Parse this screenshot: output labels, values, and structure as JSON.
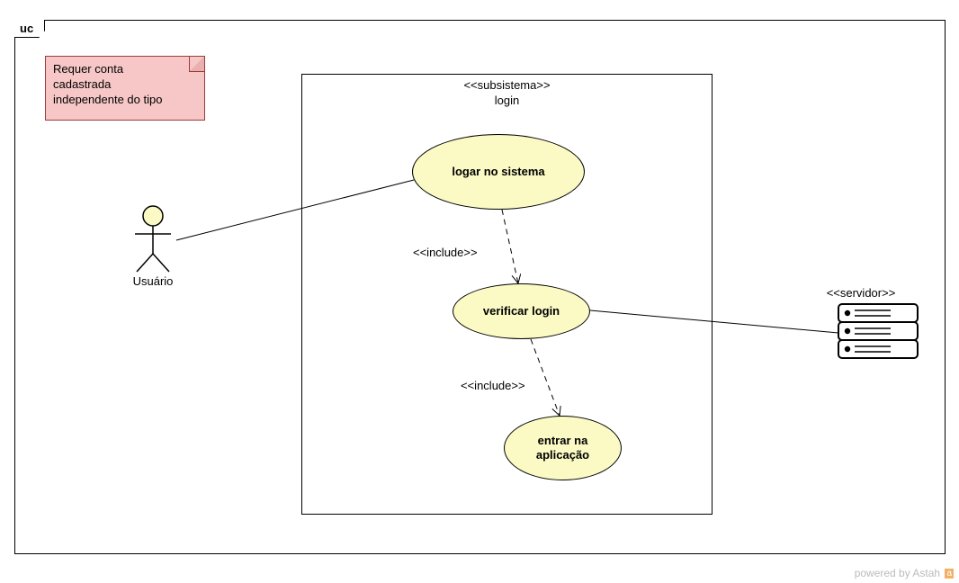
{
  "frame": {
    "label": "uc"
  },
  "note": {
    "line1": "Requer conta",
    "line2": "cadastrada",
    "line3": "independente do tipo"
  },
  "subsystem": {
    "stereotype": "<<subsistema>>",
    "name": "login"
  },
  "usecases": {
    "uc1": "logar no sistema",
    "uc2": "verificar login",
    "uc3_line1": "entrar na",
    "uc3_line2": "aplicação"
  },
  "actors": {
    "user": "Usuário",
    "server_stereo": "<<servidor>>"
  },
  "relations": {
    "include1": "<<include>>",
    "include2": "<<include>>"
  },
  "footer": {
    "powered": "powered by ",
    "brand": "Astah",
    "badge": "a"
  }
}
